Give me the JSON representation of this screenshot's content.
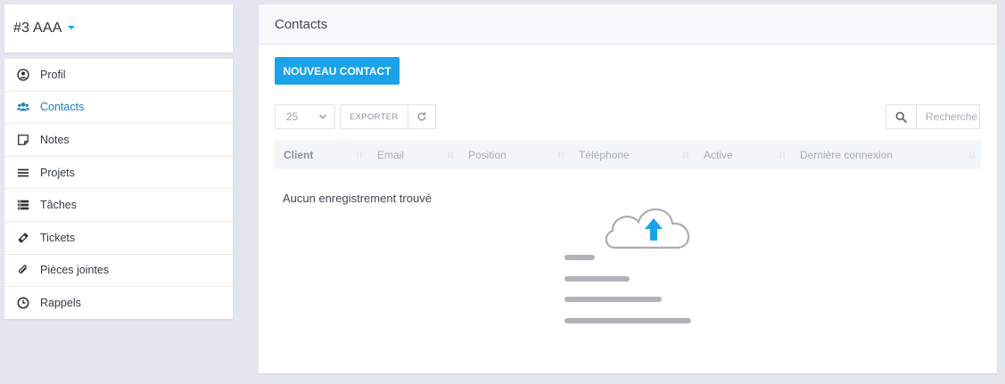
{
  "client": {
    "name": "#3 AAA"
  },
  "sidebar": {
    "items": [
      {
        "label": "Profil",
        "icon": "user-circle-icon"
      },
      {
        "label": "Contacts",
        "icon": "users-icon"
      },
      {
        "label": "Notes",
        "icon": "note-icon"
      },
      {
        "label": "Projets",
        "icon": "bars-icon"
      },
      {
        "label": "Tâches",
        "icon": "tasks-icon"
      },
      {
        "label": "Tickets",
        "icon": "ticket-icon"
      },
      {
        "label": "Pièces jointes",
        "icon": "paperclip-icon"
      },
      {
        "label": "Rappels",
        "icon": "clock-icon"
      }
    ],
    "active_index": 1
  },
  "main": {
    "title": "Contacts",
    "new_button_label": "NOUVEAU CONTACT",
    "page_length": "25",
    "export_label": "EXPORTER",
    "search_placeholder": "Recherche",
    "columns": [
      "Client",
      "Email",
      "Position",
      "Téléphone",
      "Active",
      "Dernière connexion"
    ],
    "empty_message": "Aucun enregistrement trouvé"
  },
  "colors": {
    "accent": "#1aa3e8",
    "active_link": "#1a7fc4",
    "background": "#e3e7ed"
  }
}
